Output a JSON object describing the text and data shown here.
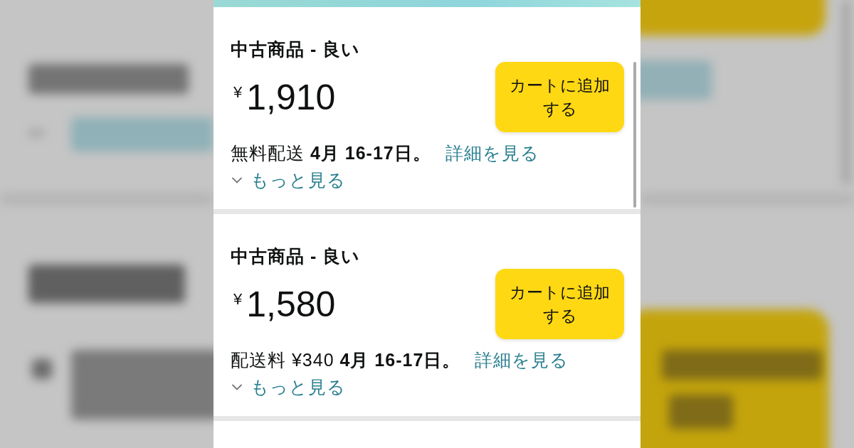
{
  "offers": [
    {
      "condition": "中古商品 - 良い",
      "currency": "¥",
      "price": "1,910",
      "add_to_cart": "カートに追加する",
      "shipping": "無料配送 **4月 16-17日。**",
      "details_link": "詳細を見る",
      "more_link": "もっと見る",
      "expanded": false
    },
    {
      "condition": "中古商品 - 良い",
      "currency": "¥",
      "price": "1,580",
      "add_to_cart": "カートに追加する",
      "shipping": "配送料 ¥340 **4月 16-17日。**",
      "details_link": "詳細を見る",
      "more_link": "もっと見る",
      "expanded": false
    }
  ]
}
